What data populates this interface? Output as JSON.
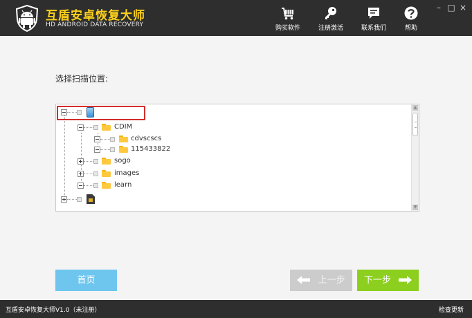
{
  "app": {
    "title": "互盾安卓恢复大师",
    "subtitle": "HD ANDROID DATA RECOVERY",
    "brand_color": "#ffd21a"
  },
  "toolbar": {
    "buy": {
      "label": "购买软件",
      "icon": "cart-icon"
    },
    "register": {
      "label": "注册激活",
      "icon": "key-icon"
    },
    "contact": {
      "label": "联系我们",
      "icon": "chat-icon"
    },
    "help": {
      "label": "帮助",
      "icon": "help-icon"
    }
  },
  "window_controls": {
    "minimize": "–",
    "maximize": "□",
    "close": "×"
  },
  "main": {
    "scan_label": "选择扫描位置:"
  },
  "tree": {
    "root_phone": {
      "label": "",
      "icon": "phone-icon",
      "expanded": true
    },
    "folders": {
      "cdim": {
        "label": "CDIM",
        "expanded": true
      },
      "cdvscscs": {
        "label": "cdvscscs",
        "expanded": true
      },
      "n115433822": {
        "label": "115433822",
        "expanded": true
      },
      "sogo": {
        "label": "sogo",
        "expanded": false
      },
      "images": {
        "label": "images",
        "expanded": false
      },
      "learn": {
        "label": "learn",
        "expanded": true
      }
    },
    "root_sdcard": {
      "label": "",
      "icon": "sdcard-icon",
      "expanded": false
    }
  },
  "buttons": {
    "home": "首页",
    "prev": "上一步",
    "next": "下一步"
  },
  "status": {
    "version": "互盾安卓恢复大师V1.0（未注册）",
    "check_update": "检查更新"
  },
  "colors": {
    "home_button": "#6ec6ef",
    "next_button": "#8ccf1e",
    "prev_button_disabled": "#cccccc",
    "selection_highlight": "#d32d2d"
  }
}
